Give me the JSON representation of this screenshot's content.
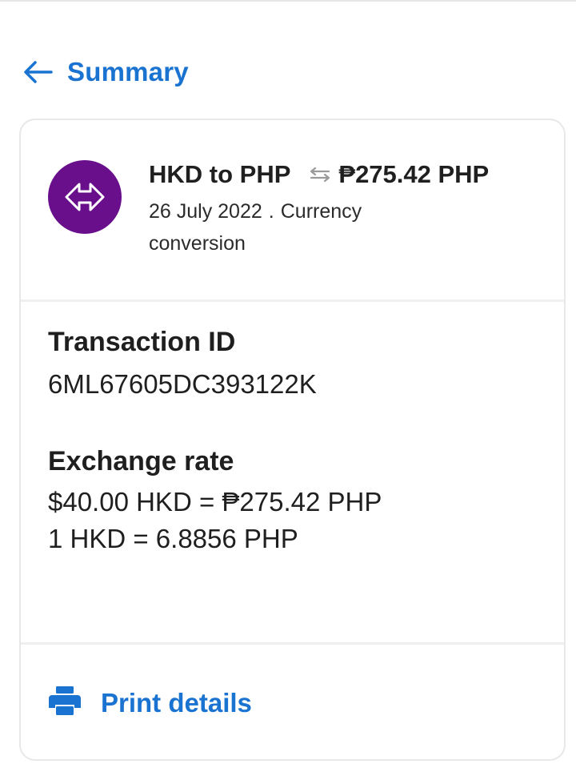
{
  "header": {
    "title": "Summary",
    "back_icon": "arrow-left-icon"
  },
  "transaction": {
    "title": "HKD to PHP",
    "amount": "₱275.42 PHP",
    "date": "26 July 2022",
    "separator": ".",
    "type": "Currency conversion",
    "avatar_icon": "currency-exchange-icon",
    "avatar_color": "#6a0f8c"
  },
  "details": {
    "transaction_id_label": "Transaction ID",
    "transaction_id": "6ML67605DC393122K",
    "exchange_rate_label": "Exchange rate",
    "exchange_rate_line1": "$40.00 HKD = ₱275.42 PHP",
    "exchange_rate_line2": "1 HKD = 6.8856 PHP"
  },
  "actions": {
    "print_label": "Print details",
    "print_icon": "printer-icon"
  },
  "colors": {
    "accent": "#1a73d1",
    "text": "#1f1f1f"
  }
}
